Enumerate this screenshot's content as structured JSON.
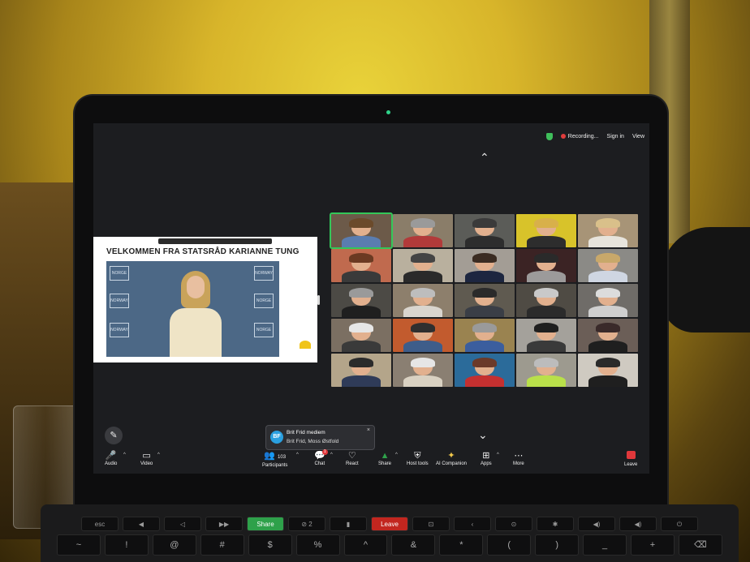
{
  "zoom": {
    "topbar": {
      "recording": "Recording...",
      "signin": "Sign in",
      "view": "View"
    },
    "share": {
      "title": "VELKOMMEN FRA STATSRÅD KARIANNE TUNG",
      "backdrop_logo_text": [
        "NORGE",
        "NORWAY",
        "NORWAY",
        "NORWAY",
        "NORGE",
        "NORGE"
      ]
    },
    "chat_toast": {
      "avatar": "BF",
      "name": "Brit Frid mediem",
      "message": "Brit Frid, Moss Østfold"
    },
    "controls": {
      "audio": "Audio",
      "video": "Video",
      "participants": "Participants",
      "participant_count": "103",
      "chat": "Chat",
      "chat_badge": "1",
      "react": "React",
      "share": "Share",
      "host_tools": "Host tools",
      "ai_companion": "AI Companion",
      "apps": "Apps",
      "more": "More",
      "leave": "Leave"
    },
    "gallery_tiles": [
      {
        "bg": "#6c5a49",
        "hair": "#6b4a2b",
        "torso": "#5a7db0"
      },
      {
        "bg": "#8a7d69",
        "hair": "#9a9a9a",
        "torso": "#b23a3a"
      },
      {
        "bg": "#5b5c58",
        "hair": "#3a3a3a",
        "torso": "#2d2d2d"
      },
      {
        "bg": "#d8c32a",
        "hair": "#d8b04a",
        "torso": "#2d2d2d"
      },
      {
        "bg": "#a79477",
        "hair": "#d9c08a",
        "torso": "#e7e4dc"
      },
      {
        "bg": "#c06a4e",
        "hair": "#6b3a22",
        "torso": "#3a3a3a"
      },
      {
        "bg": "#b9b09e",
        "hair": "#444",
        "torso": "#2a2a2a"
      },
      {
        "bg": "#a39d95",
        "hair": "#3b2c22",
        "torso": "#1d2640"
      },
      {
        "bg": "#3b2324",
        "hair": "#2a2a2a",
        "torso": "#9c9a9a"
      },
      {
        "bg": "#8b8a86",
        "hair": "#c8a86a",
        "torso": "#cfd6e2"
      },
      {
        "bg": "#4c4a45",
        "hair": "#9a9a9a",
        "torso": "#1f1f1f"
      },
      {
        "bg": "#8d7f6c",
        "hair": "#bdbdbd",
        "torso": "#d9d5ce"
      },
      {
        "bg": "#5f5a50",
        "hair": "#2a2a2a",
        "torso": "#3a3e46"
      },
      {
        "bg": "#4f4b44",
        "hair": "#c9c9c9",
        "torso": "#2b2b2b"
      },
      {
        "bg": "#6f6c68",
        "hair": "#dcdcdc",
        "torso": "#cfcfcf"
      },
      {
        "bg": "#7b6f62",
        "hair": "#e6e6e6",
        "torso": "#3a3a3a"
      },
      {
        "bg": "#c25b2e",
        "hair": "#2f2f2f",
        "torso": "#3e5d8a"
      },
      {
        "bg": "#9a8350",
        "hair": "#9a9a9a",
        "torso": "#3b5e9e"
      },
      {
        "bg": "#a4a19b",
        "hair": "#1f1f1f",
        "torso": "#3a3a3a"
      },
      {
        "bg": "#6b5e57",
        "hair": "#3a2a2a",
        "torso": "#1f1f1f"
      },
      {
        "bg": "#b4a58a",
        "hair": "#2b2b2b",
        "torso": "#2f3b58"
      },
      {
        "bg": "#8a7f72",
        "hair": "#e6e6e6",
        "torso": "#d9d1c2"
      },
      {
        "bg": "#2b6b9a",
        "hair": "#6b3a2a",
        "torso": "#c43030"
      },
      {
        "bg": "#9d9a8f",
        "hair": "#bcbcbc",
        "torso": "#b9e04a"
      },
      {
        "bg": "#cfcac1",
        "hair": "#2a2a2a",
        "torso": "#1f1f1f"
      }
    ]
  },
  "keyboard": {
    "touchbar": [
      "esc",
      "◀",
      "◁",
      "▶▶",
      "Share screen",
      "⊘ 2",
      "▮",
      "Leave",
      "⊡",
      "‹",
      "⊙",
      "✱",
      "◀)",
      "◀)",
      "⏻"
    ],
    "keys": [
      "~",
      "!",
      "@",
      "#",
      "$",
      "%",
      "^",
      "&",
      "*",
      "(",
      ")",
      "_",
      "+",
      "⌫"
    ]
  }
}
